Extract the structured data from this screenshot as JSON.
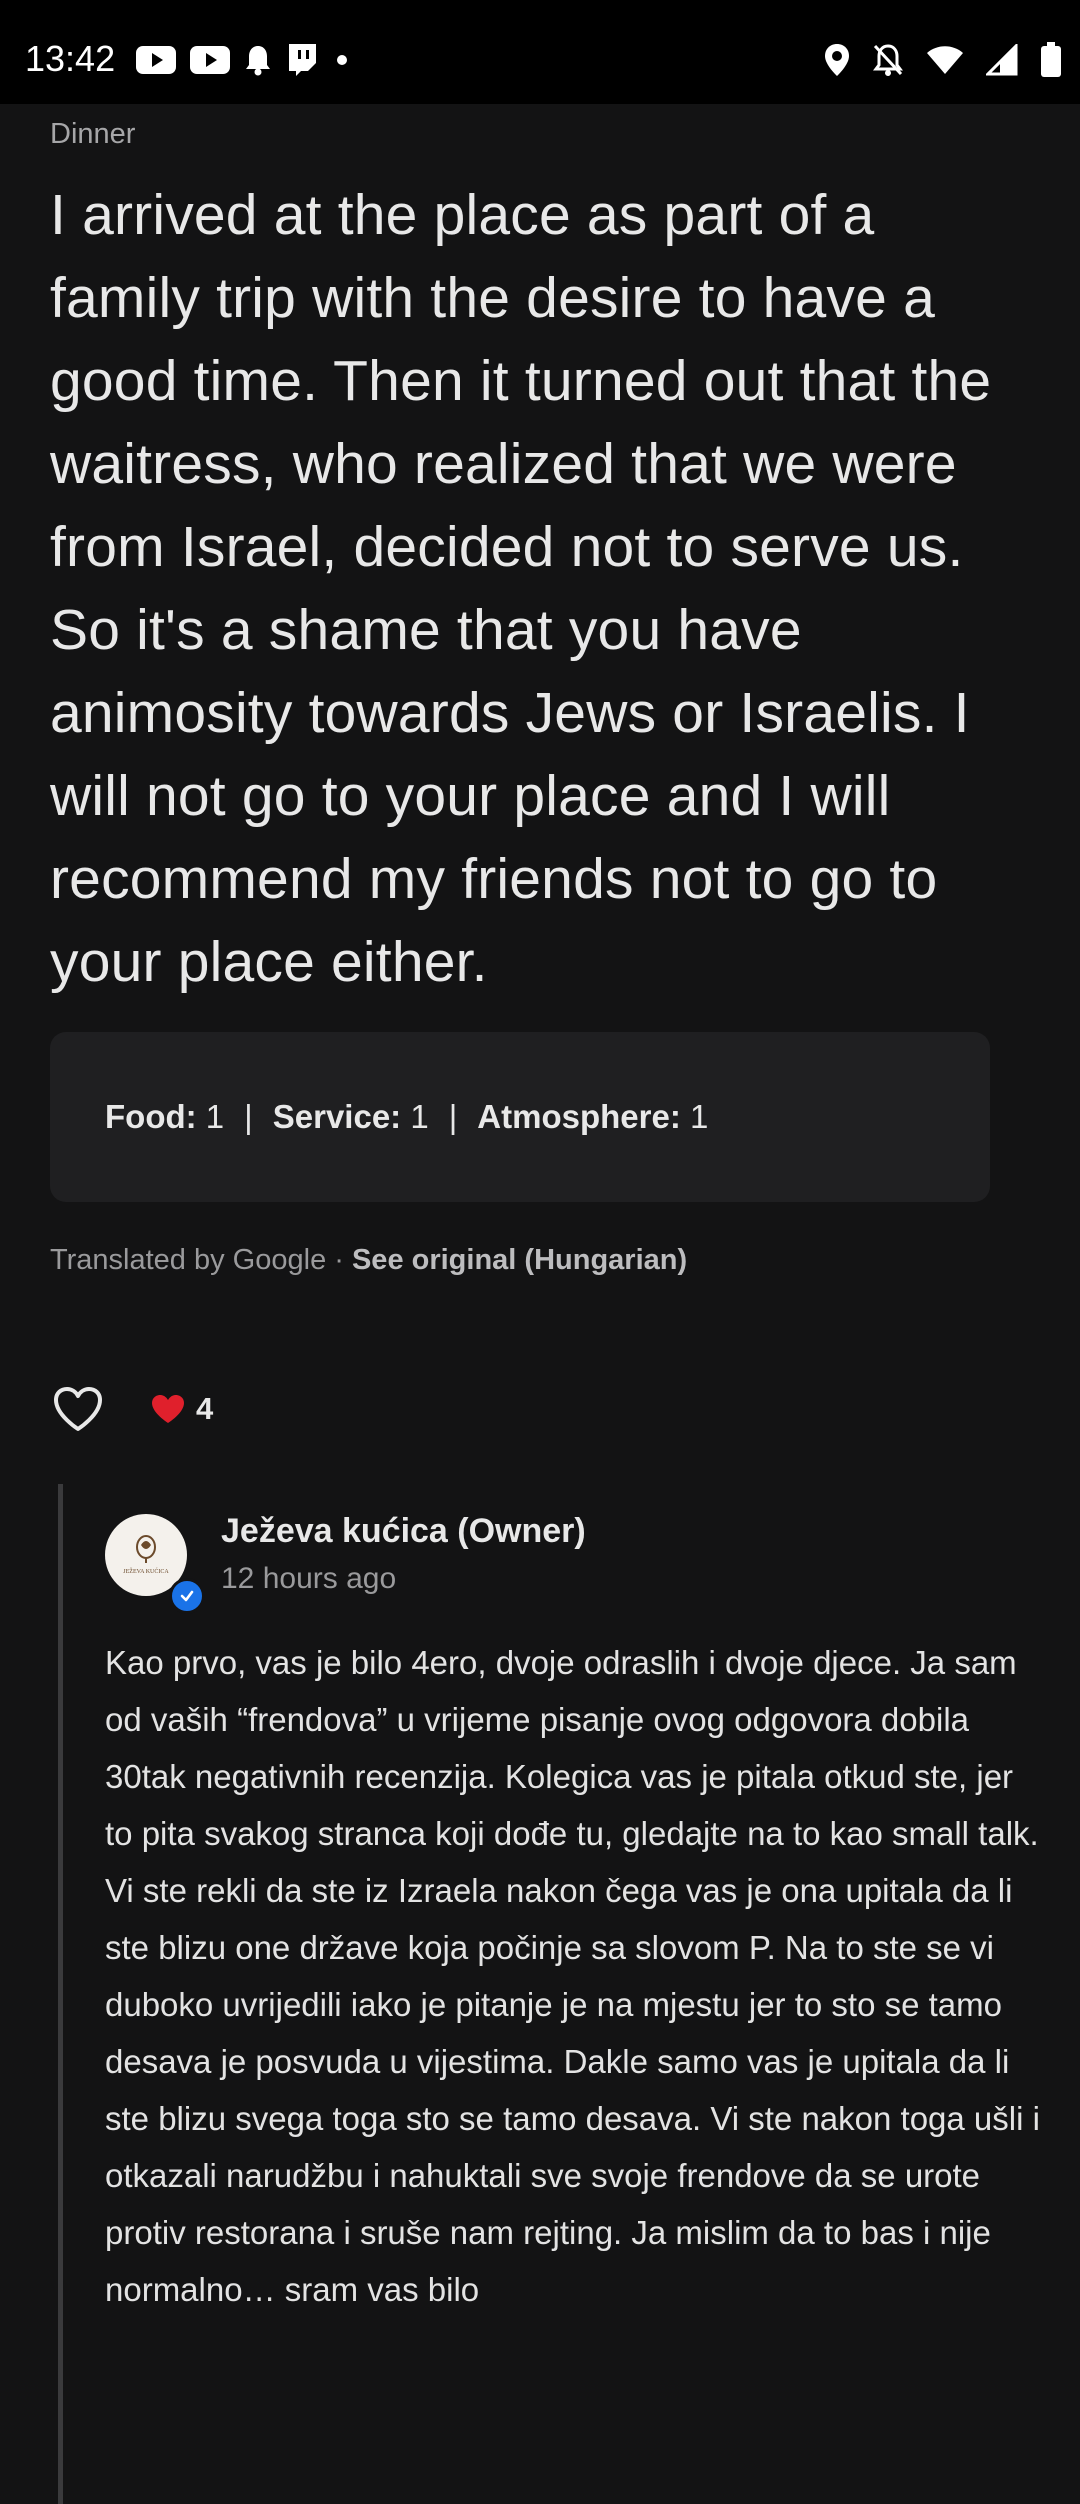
{
  "status_bar": {
    "time": "13:42",
    "left_icons": [
      "youtube-icon",
      "youtube-icon",
      "notification-bell-icon",
      "twitch-icon",
      "dot-icon"
    ],
    "right_icons": [
      "location-icon",
      "do-not-disturb-off-icon",
      "wifi-icon",
      "signal-icon",
      "battery-icon"
    ]
  },
  "review": {
    "meal_type": "Dinner",
    "text": "I arrived at the place as part of a family trip with the desire to have a good time. Then it turned out that the waitress, who realized that we were from Israel, decided not to serve us. So it's a shame that you have animosity towards Jews or Israelis. I will not go to your place and I will recommend my friends not to go to your place either.",
    "ratings": [
      {
        "label": "Food:",
        "value": "1"
      },
      {
        "label": "Service:",
        "value": "1"
      },
      {
        "label": "Atmosphere:",
        "value": "1"
      }
    ],
    "translated_by": "Translated by Google · ",
    "see_original": "See original (Hungarian)",
    "reaction_count": "4"
  },
  "owner_response": {
    "name": "Ježeva kućica (Owner)",
    "time": "12 hours ago",
    "avatar_logo_text": "JEŽEVA KUĆICA",
    "text": "Kao prvo, vas je bilo 4ero, dvoje odraslih i dvoje djece. Ja sam od vaših “frendova” u vrijeme pisanje ovog odgovora dobila 30tak negativnih recenzija. Kolegica vas je pitala otkud ste, jer to pita svakog stranca koji dođe tu, gledajte na to kao small talk. Vi ste rekli da ste iz Izraela nakon čega vas je ona upitala da li ste blizu one države koja počinje sa slovom P. Na to ste se vi duboko uvrijedili iako je pitanje je na mjestu jer to sto se tamo desava je posvuda u vijestima. Dakle samo vas je upitala da li ste blizu svega toga sto se tamo desava. Vi ste nakon toga ušli i otkazali narudžbu i nahuktali sve svoje frendove da se urote protiv restorana i sruše nam rejting. Ja mislim da to bas i nije normalno… sram vas bilo"
  }
}
